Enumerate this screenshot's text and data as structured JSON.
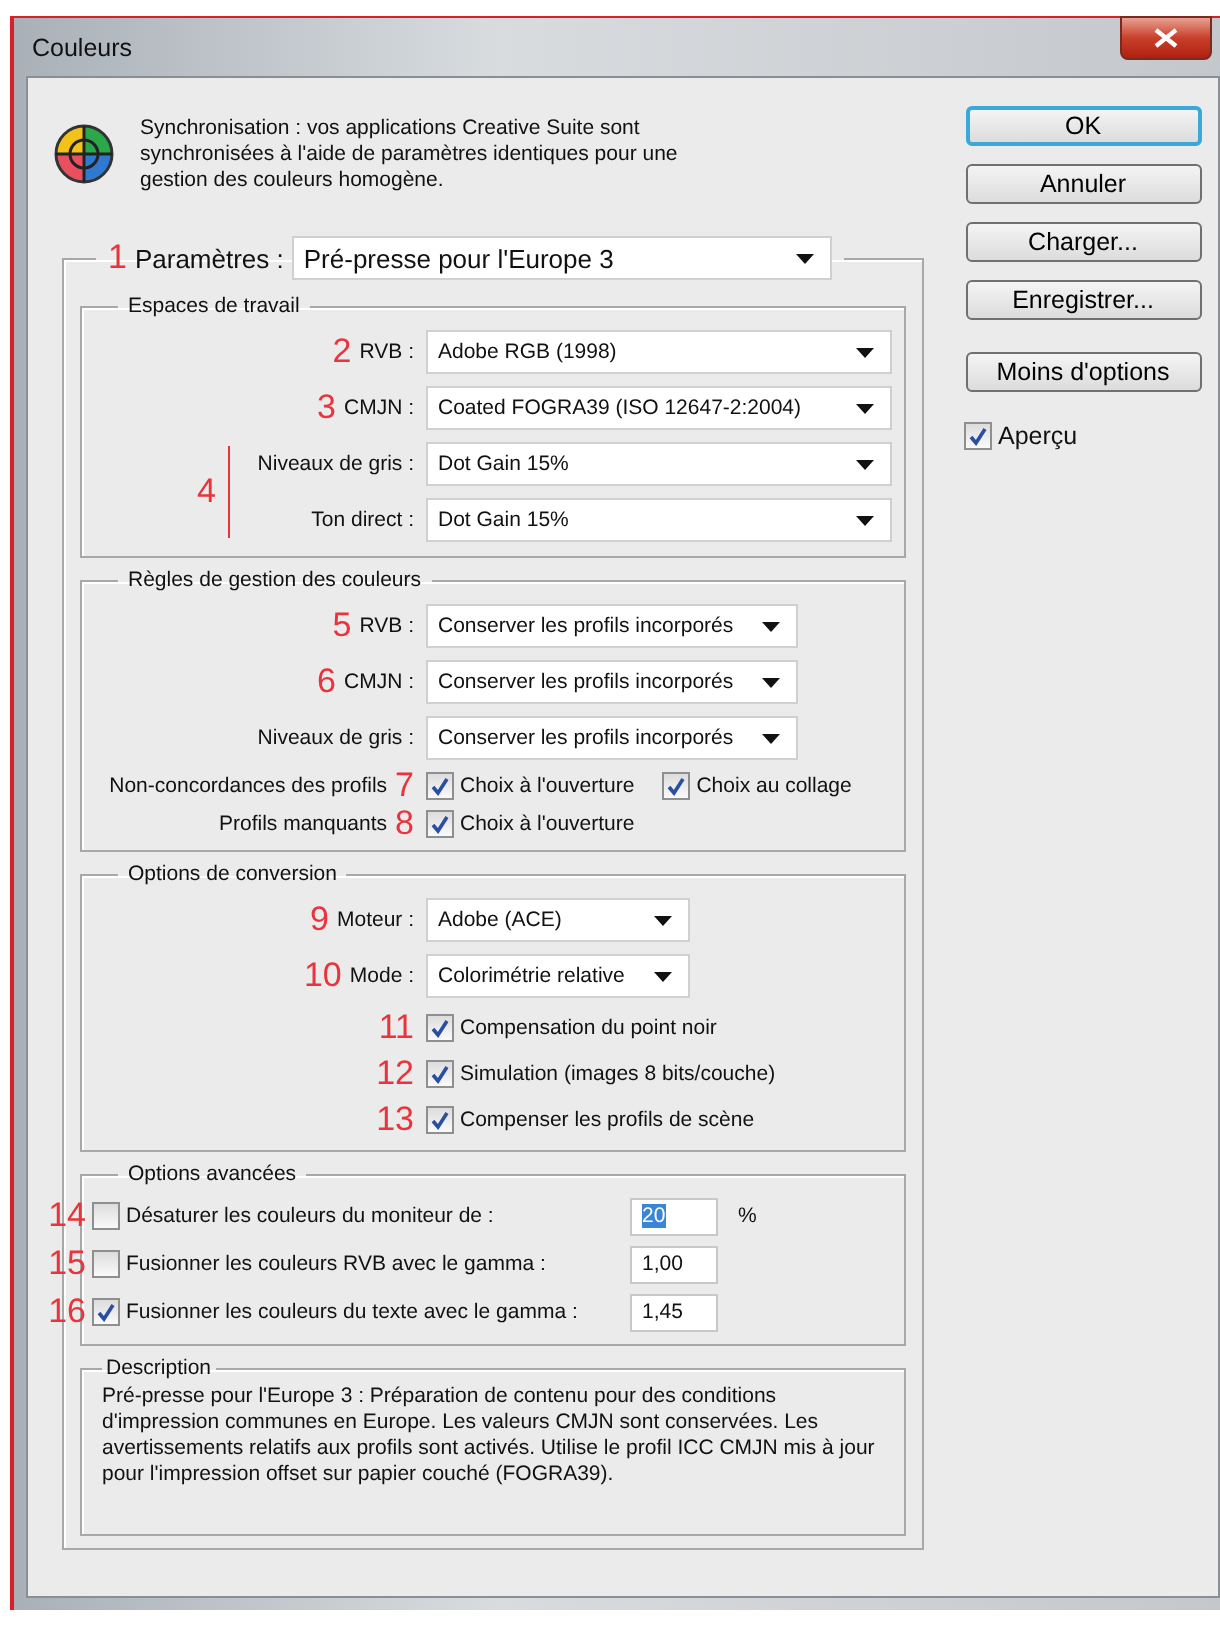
{
  "window": {
    "title": "Couleurs"
  },
  "sync": {
    "text": "Synchronisation : vos applications Creative Suite sont synchronisées à l'aide de paramètres identiques pour une gestion des couleurs homogène."
  },
  "settings": {
    "number": "1",
    "label": "Paramètres :",
    "value": "Pré-presse pour l'Europe 3"
  },
  "sections": [
    {
      "kind": "spaces",
      "title": "Espaces de travail",
      "items": [
        {
          "kind": "select",
          "number": "2",
          "label": "RVB :",
          "value": "Adobe RGB (1998)"
        },
        {
          "kind": "select",
          "number": "3",
          "label": "CMJN :",
          "value": "Coated FOGRA39 (ISO 12647-2:2004)"
        },
        {
          "kind": "bracket",
          "number": "4",
          "items": [
            {
              "kind": "select",
              "label": "Niveaux de gris :",
              "value": "Dot Gain 15%"
            },
            {
              "kind": "select",
              "label": "Ton direct :",
              "value": "Dot Gain 15%"
            }
          ]
        }
      ]
    },
    {
      "kind": "rules",
      "title": "Règles de gestion des couleurs",
      "items": [
        {
          "kind": "select",
          "number": "5",
          "label": "RVB :",
          "value": "Conserver les profils incorporés"
        },
        {
          "kind": "select",
          "number": "6",
          "label": "CMJN :",
          "value": "Conserver les profils incorporés"
        },
        {
          "kind": "select",
          "label": "Niveaux de gris :",
          "value": "Conserver les profils incorporés"
        },
        {
          "kind": "checks",
          "label": "Non-concordances des profils",
          "number": "7",
          "checks": [
            {
              "label": "Choix à l'ouverture",
              "checked": true
            },
            {
              "label": "Choix au collage",
              "checked": true
            }
          ]
        },
        {
          "kind": "checks",
          "label": "Profils manquants",
          "number": "8",
          "checks": [
            {
              "label": "Choix à l'ouverture",
              "checked": true
            }
          ]
        }
      ]
    },
    {
      "kind": "conversion",
      "title": "Options de conversion",
      "items": [
        {
          "kind": "select",
          "number": "9",
          "label": "Moteur :",
          "value": "Adobe (ACE)"
        },
        {
          "kind": "select",
          "number": "10",
          "label": "Mode :",
          "value": "Colorimétrie relative"
        },
        {
          "kind": "checks",
          "number": "11",
          "checks": [
            {
              "label": "Compensation du point noir",
              "checked": true
            }
          ]
        },
        {
          "kind": "checks",
          "number": "12",
          "checks": [
            {
              "label": "Simulation (images 8 bits/couche)",
              "checked": true
            }
          ]
        },
        {
          "kind": "checks",
          "number": "13",
          "checks": [
            {
              "label": "Compenser les profils de scène",
              "checked": true
            }
          ]
        }
      ]
    },
    {
      "kind": "advanced",
      "title": "Options avancées",
      "items": [
        {
          "kind": "option",
          "number": "14",
          "checked": false,
          "label": "Désaturer les couleurs du moniteur de :",
          "value": "20",
          "value_selected": true,
          "unit": "%"
        },
        {
          "kind": "option",
          "number": "15",
          "checked": false,
          "label": "Fusionner les couleurs RVB avec le gamma :",
          "value": "1,00",
          "value_selected": false
        },
        {
          "kind": "option",
          "number": "16",
          "checked": true,
          "label": "Fusionner les couleurs du texte avec le gamma :",
          "value": "1,45",
          "value_selected": false
        }
      ]
    },
    {
      "kind": "description",
      "title": "Description",
      "text": "Pré-presse pour l'Europe 3 :  Préparation de contenu pour des conditions d'impression communes en Europe. Les valeurs CMJN sont conservées. Les avertissements relatifs aux profils sont activés. Utilise le profil ICC CMJN mis à jour pour l'impression offset sur papier couché (FOGRA39)."
    }
  ],
  "buttons": [
    {
      "label": "OK",
      "default": true
    },
    {
      "label": "Annuler",
      "default": false
    },
    {
      "label": "Charger...",
      "default": false
    },
    {
      "label": "Enregistrer...",
      "default": false
    },
    {
      "label": "Moins d'options",
      "default": false
    }
  ],
  "preview": {
    "label": "Aperçu",
    "checked": true
  }
}
